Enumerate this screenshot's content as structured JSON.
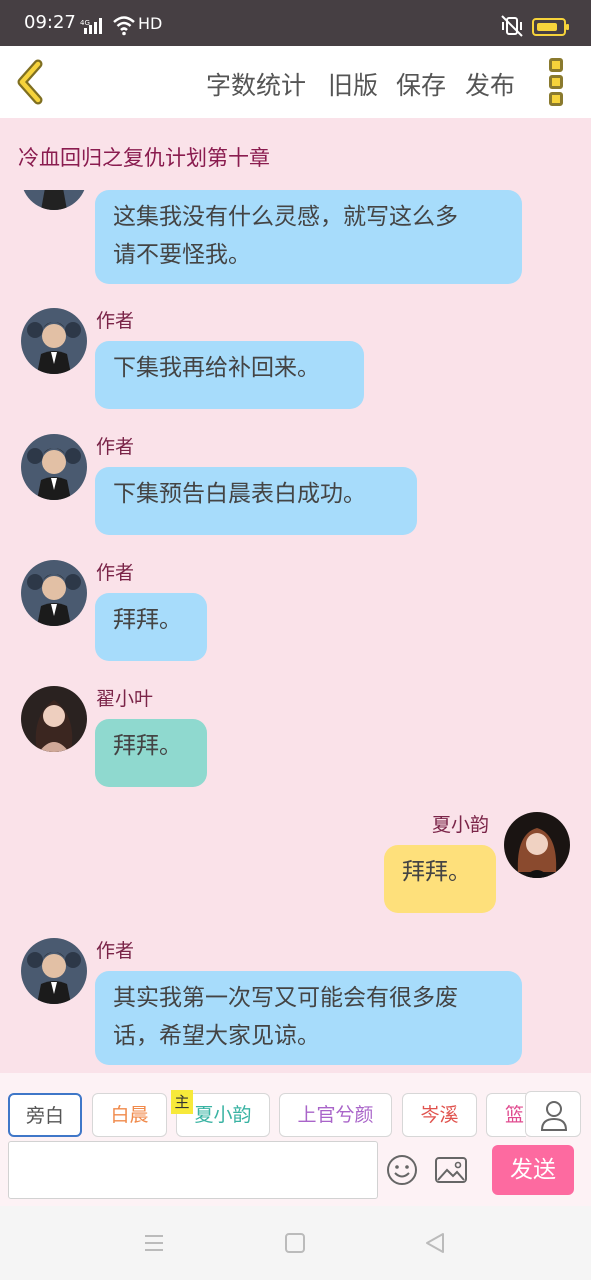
{
  "status_bar": {
    "time": "09:27",
    "network": "4G",
    "hd": "HD",
    "accent": "#f6d33b"
  },
  "toolbar": {
    "items": [
      "字数统计",
      "旧版",
      "保存",
      "发布"
    ],
    "icons": {
      "back": "chevron-left-icon",
      "more": "more-vertical-icon"
    },
    "accent": "#f6d33b"
  },
  "chapter": {
    "title": "冷血回归之复仇计划第十章"
  },
  "messages": [
    {
      "side": "left",
      "name": "",
      "text_lines": [
        "这集我没有什么灵感，就写这么多",
        "请不要怪我。"
      ],
      "color": "#a7dcfb"
    },
    {
      "side": "left",
      "name": "作者",
      "text_lines": [
        "下集我再给补回来。"
      ],
      "color": "#a7dcfb"
    },
    {
      "side": "left",
      "name": "作者",
      "text_lines": [
        "下集预告白晨表白成功。"
      ],
      "color": "#a7dcfb"
    },
    {
      "side": "left",
      "name": "作者",
      "text_lines": [
        "拜拜。"
      ],
      "color": "#a7dcfb"
    },
    {
      "side": "left",
      "name": "翟小叶",
      "text_lines": [
        "拜拜。"
      ],
      "color": "#8fd9cf"
    },
    {
      "side": "right",
      "name": "夏小韵",
      "text_lines": [
        "拜拜。"
      ],
      "color": "#fee07b"
    },
    {
      "side": "left",
      "name": "作者",
      "text_lines": [
        "其实我第一次写又可能会有很多废",
        "话，希望大家见谅。"
      ],
      "color": "#a7dcfb"
    }
  ],
  "characters": [
    {
      "label": "旁白",
      "color": "#555555",
      "active": true
    },
    {
      "label": "白晨",
      "color": "#f08a4b",
      "active": false
    },
    {
      "label": "夏小韵",
      "color": "#3ab3a3",
      "active": false
    },
    {
      "label": "上官兮颜",
      "color": "#a964c9",
      "active": false
    },
    {
      "label": "岑溪",
      "color": "#e0524d",
      "active": false
    },
    {
      "label": "篮",
      "color": "#e04b8f",
      "active": false
    }
  ],
  "main_tag": "主",
  "input": {
    "value": "",
    "placeholder": ""
  },
  "send_label": "发送",
  "send_color": "#fd6aa0",
  "background": "#fae2e9"
}
